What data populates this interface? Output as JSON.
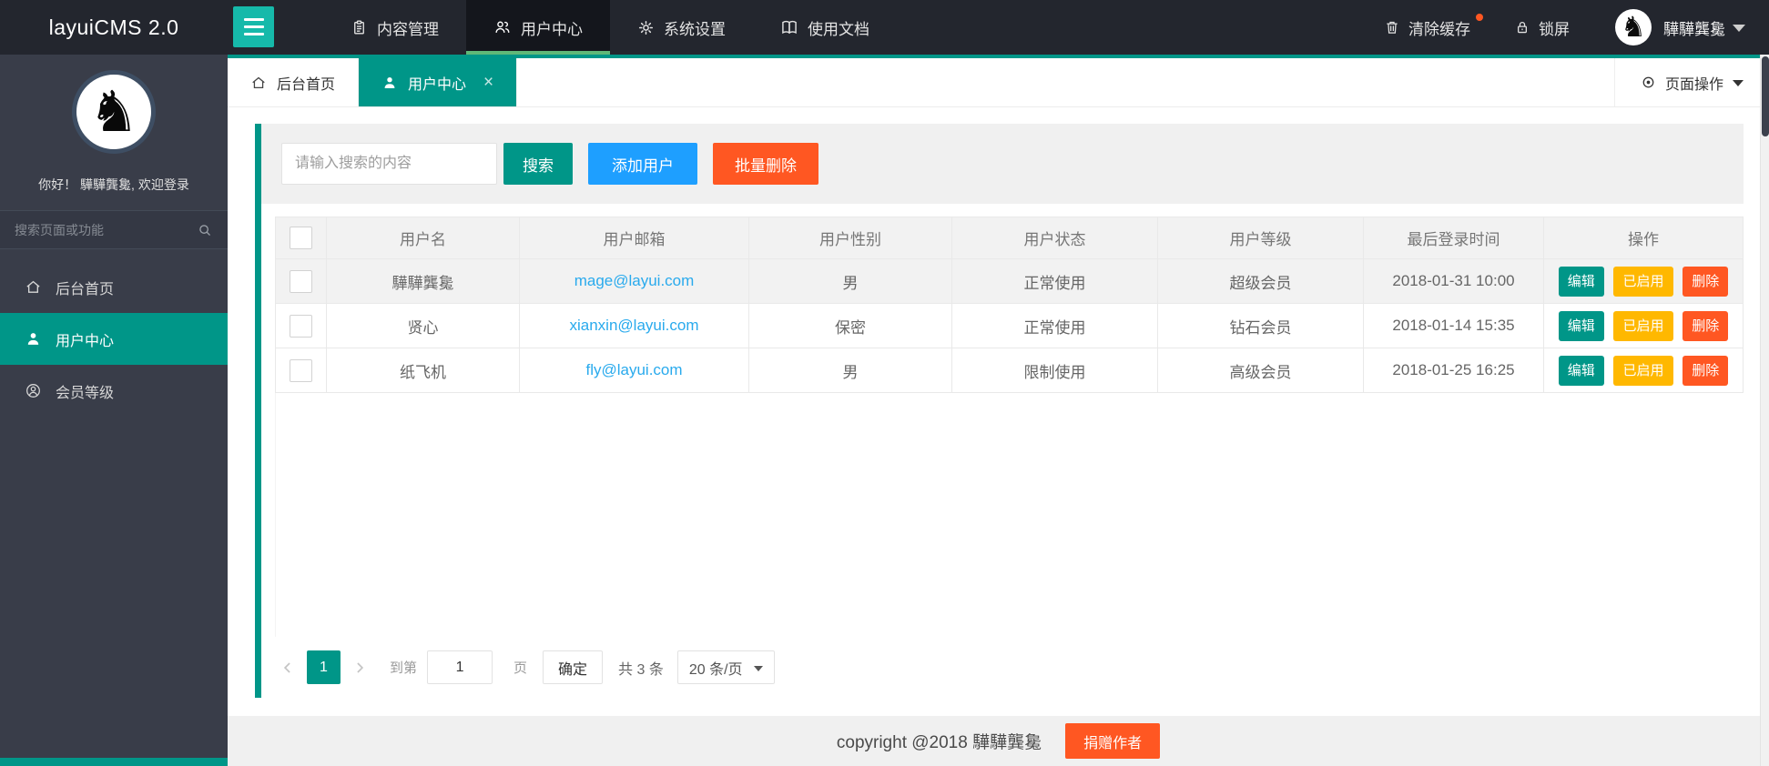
{
  "topbar": {
    "logo": "layuiCMS 2.0",
    "nav_items": [
      {
        "label": "内容管理",
        "icon": "clipboard-icon",
        "active": false
      },
      {
        "label": "用户中心",
        "icon": "users-icon",
        "active": true
      },
      {
        "label": "系统设置",
        "icon": "gear-icon",
        "active": false
      },
      {
        "label": "使用文档",
        "icon": "book-icon",
        "active": false
      }
    ],
    "clear_cache_label": "清除缓存",
    "lock_label": "锁屏",
    "username": "驊驊龔毚"
  },
  "sidebar": {
    "greeting": "你好！ 驊驊龔毚, 欢迎登录",
    "search_placeholder": "搜索页面或功能",
    "menu_items": [
      {
        "label": "后台首页",
        "icon": "home-icon",
        "active": false
      },
      {
        "label": "用户中心",
        "icon": "user-icon",
        "active": true
      },
      {
        "label": "会员等级",
        "icon": "member-icon",
        "active": false
      }
    ]
  },
  "tabbar": {
    "tabs": [
      {
        "label": "后台首页",
        "icon": "home-icon",
        "active": false,
        "closable": false
      },
      {
        "label": "用户中心",
        "icon": "user-icon",
        "active": true,
        "closable": true
      }
    ],
    "close_glyph": "×",
    "page_ops_label": "页面操作"
  },
  "toolbar": {
    "search_placeholder": "请输入搜索的内容",
    "search_label": "搜索",
    "add_user_label": "添加用户",
    "bulk_delete_label": "批量删除"
  },
  "table": {
    "headers": [
      "用户名",
      "用户邮箱",
      "用户性别",
      "用户状态",
      "用户等级",
      "最后登录时间",
      "操作"
    ],
    "action_labels": {
      "edit": "编辑",
      "enabled": "已启用",
      "delete": "删除"
    },
    "rows": [
      {
        "name": "驊驊龔毚",
        "email": "mage@layui.com",
        "gender": "男",
        "status": "正常使用",
        "level": "超级会员",
        "last_login": "2018-01-31 10:00"
      },
      {
        "name": "贤心",
        "email": "xianxin@layui.com",
        "gender": "保密",
        "status": "正常使用",
        "level": "钻石会员",
        "last_login": "2018-01-14 15:35"
      },
      {
        "name": "纸飞机",
        "email": "fly@layui.com",
        "gender": "男",
        "status": "限制使用",
        "level": "高级会员",
        "last_login": "2018-01-25 16:25"
      }
    ]
  },
  "pagination": {
    "current_page": "1",
    "goto_prefix": "到第",
    "goto_value": "1",
    "goto_suffix": "页",
    "confirm_label": "确定",
    "total_label": "共 3 条",
    "per_page_label": "20 条/页"
  },
  "footer": {
    "copyright": "copyright @2018 驊驊龔毚",
    "donate_label": "捐赠作者"
  },
  "colors": {
    "accent_teal": "#009688",
    "brand_green": "#16b9aa",
    "active_underline_green": "#5FB878",
    "blue": "#1E9FFF",
    "orange": "#FF5722",
    "yellow": "#FFB800",
    "link_blue": "#29aaed",
    "topbar_bg": "#23262e",
    "sidebar_bg": "#393d49"
  }
}
